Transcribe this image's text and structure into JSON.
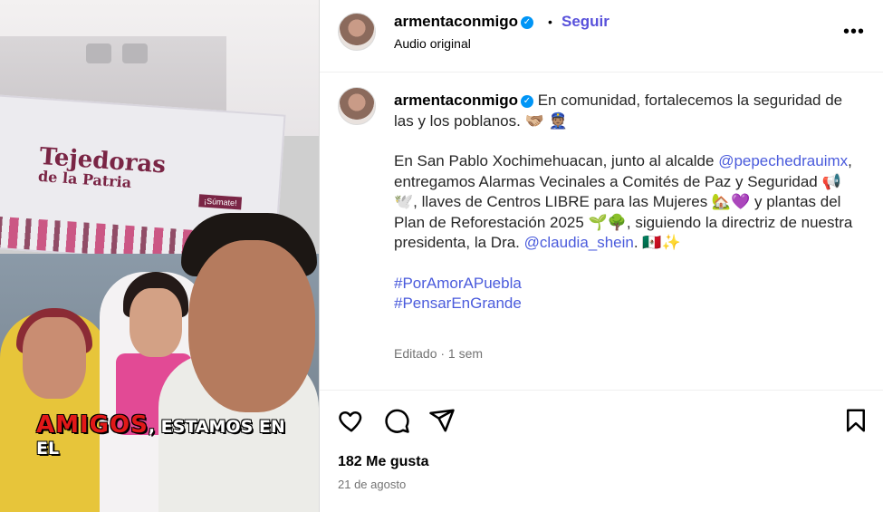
{
  "media": {
    "banner_line1": "Tejedoras",
    "banner_line2": "de la Patria",
    "banner_tag": "¡Súmate!",
    "caption_highlight": "AMIGOS",
    "caption_rest": ", ESTAMOS EN EL"
  },
  "header": {
    "username": "armentaconmigo",
    "verified_icon": "✓",
    "separator": "•",
    "follow_label": "Seguir",
    "audio_label": "Audio original",
    "more_icon": "•••"
  },
  "caption": {
    "username": "armentaconmigo",
    "line1": " En comunidad, fortalecemos la seguridad de las y los poblanos. 🫱🏼‍🫲🏽 👮🏽",
    "para2_a": "En San Pablo Xochimehuacan, junto al alcalde ",
    "mention1": "@pepechedrauimx",
    "para2_b": ", entregamos Alarmas Vecinales a Comités de Paz y Seguridad 📢🕊️, llaves de Centros LIBRE para las Mujeres 🏡💜 y plantas del Plan de Reforestación 2025 🌱🌳, siguiendo la directriz de nuestra presidenta, la Dra. ",
    "mention2": "@claudia_shein",
    "para2_c": ". 🇲🇽✨",
    "hashtag1": "#PorAmorAPuebla",
    "hashtag2": "#PensarEnGrande",
    "meta": "Editado · 1 sem"
  },
  "actions": {
    "like_icon": "heart-icon",
    "comment_icon": "comment-icon",
    "share_icon": "share-icon",
    "save_icon": "bookmark-icon",
    "likes_text": "182 Me gusta",
    "date_text": "21 de agosto"
  },
  "colors": {
    "accent": "#5851db",
    "link": "#4a5bdc",
    "verified": "#0095f6",
    "muted": "#737373"
  }
}
